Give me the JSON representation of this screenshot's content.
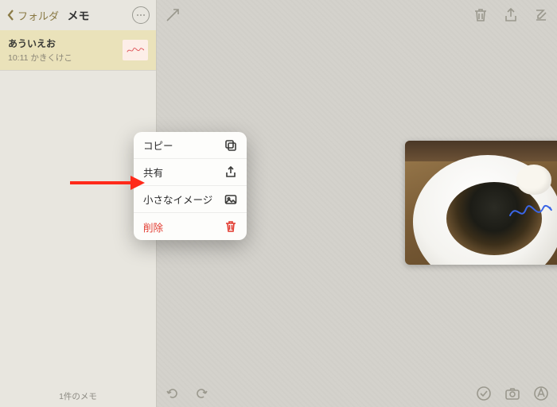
{
  "sidebar": {
    "back_label": "フォルダ",
    "title": "メモ",
    "notes": [
      {
        "title": "あういえお",
        "time": "10:11",
        "preview": "かきくけこ"
      }
    ],
    "footer": "1件のメモ"
  },
  "context_menu": {
    "items": [
      {
        "label": "コピー",
        "icon": "copy-icon",
        "danger": false
      },
      {
        "label": "共有",
        "icon": "share-icon",
        "danger": false
      },
      {
        "label": "小さなイメージ",
        "icon": "image-icon",
        "danger": false
      },
      {
        "label": "削除",
        "icon": "trash-icon",
        "danger": true
      }
    ]
  },
  "annotation": {
    "arrow_color": "#ff2a1a"
  },
  "attachment": {
    "bowl_color": "#ffffff"
  }
}
